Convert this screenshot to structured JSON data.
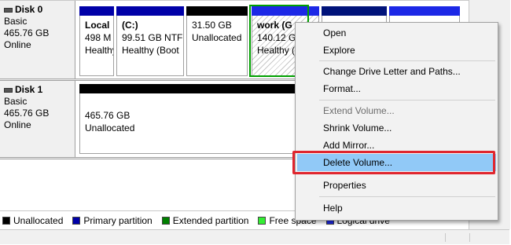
{
  "disks": [
    {
      "name": "Disk 0",
      "type": "Basic",
      "size": "465.76 GB",
      "status": "Online"
    },
    {
      "name": "Disk 1",
      "type": "Basic",
      "size": "465.76 GB",
      "status": "Online"
    }
  ],
  "disk0_partitions": [
    {
      "name": "Local",
      "size": "498 M",
      "status": "Healthy"
    },
    {
      "name": "(C:)",
      "size": "99.51 GB NTFS",
      "status": "Healthy (Boot"
    },
    {
      "name": "",
      "size": "31.50 GB",
      "status": "Unallocated"
    },
    {
      "name": "work  (G",
      "size": "140.12 GB",
      "status": "Healthy ("
    },
    {
      "name": "",
      "size": "",
      "status": ""
    },
    {
      "name": "",
      "size": "",
      "status": ""
    }
  ],
  "disk1_partitions": [
    {
      "size": "465.76 GB",
      "status": "Unallocated"
    }
  ],
  "legend": [
    {
      "label": "Unallocated",
      "color": "#000000"
    },
    {
      "label": "Primary partition",
      "color": "#0000a8"
    },
    {
      "label": "Extended partition",
      "color": "#008000"
    },
    {
      "label": "Free space",
      "color": "#33ee33"
    },
    {
      "label": "Logical drive",
      "color": "#1c28e6"
    }
  ],
  "context_menu": {
    "open": "Open",
    "explore": "Explore",
    "change_letter": "Change Drive Letter and Paths...",
    "format": "Format...",
    "extend": "Extend Volume...",
    "shrink": "Shrink Volume...",
    "add_mirror": "Add Mirror...",
    "delete": "Delete Volume...",
    "properties": "Properties",
    "help": "Help"
  }
}
